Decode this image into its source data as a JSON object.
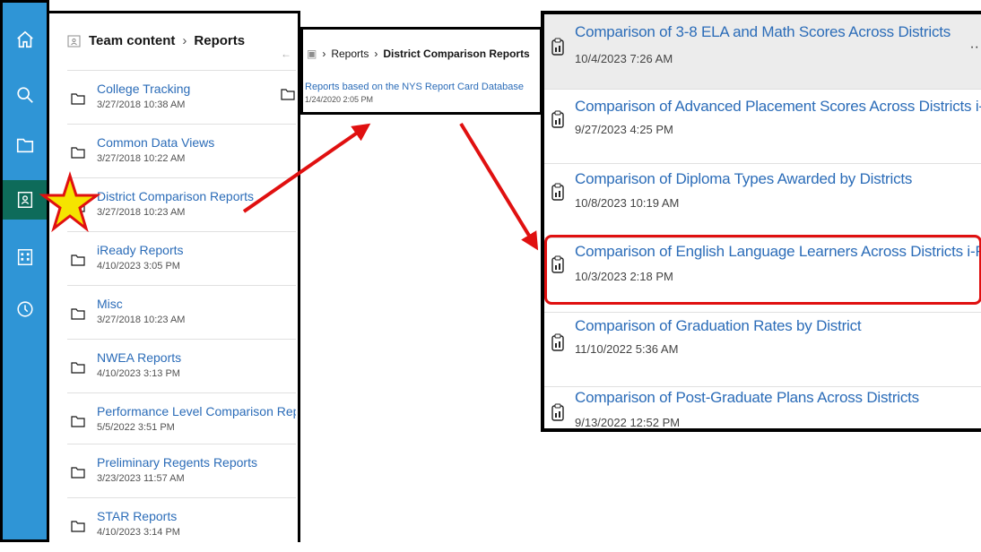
{
  "rail": {
    "items": [
      {
        "icon": "home-icon"
      },
      {
        "icon": "search-icon"
      },
      {
        "icon": "folder-icon"
      },
      {
        "icon": "team-content-icon",
        "active": true
      },
      {
        "icon": "building-icon"
      },
      {
        "icon": "clock-icon"
      }
    ],
    "active_color": "#0e6b5a",
    "background": "#2f95d6"
  },
  "panel1": {
    "breadcrumb": {
      "root": "Team content",
      "separator": "›",
      "current": "Reports"
    },
    "back_glyph": "←",
    "folders": [
      {
        "name": "College Tracking",
        "date": "3/27/2018 10:38 AM"
      },
      {
        "name": "Common Data Views",
        "date": "3/27/2018 10:22 AM"
      },
      {
        "name": "District Comparison Reports",
        "date": "3/27/2018 10:23 AM"
      },
      {
        "name": "iReady Reports",
        "date": "4/10/2023 3:05 PM"
      },
      {
        "name": "Misc",
        "date": "3/27/2018 10:23 AM"
      },
      {
        "name": "NWEA Reports",
        "date": "4/10/2023 3:13 PM"
      },
      {
        "name": "Performance Level Comparison Repor",
        "date": "5/5/2022 3:51 PM"
      },
      {
        "name": "Preliminary Regents Reports",
        "date": "3/23/2023 11:57 AM"
      },
      {
        "name": "STAR Reports",
        "date": "4/10/2023 3:14 PM"
      }
    ]
  },
  "panel2": {
    "breadcrumb": {
      "separator": "›",
      "parent": "Reports",
      "current": "District Comparison Reports"
    },
    "item": {
      "name": "Reports based on the NYS Report Card Database",
      "date": "1/24/2020 2:05 PM"
    }
  },
  "panel3": {
    "more_glyph": "··",
    "reports": [
      {
        "name": "Comparison of 3-8 ELA and Math Scores Across Districts",
        "date": "10/4/2023 7:26 AM"
      },
      {
        "name": "Comparison of Advanced Placement Scores Across Districts i-Report",
        "date": "9/27/2023 4:25 PM"
      },
      {
        "name": "Comparison of Diploma Types Awarded by Districts",
        "date": "10/8/2023 10:19 AM"
      },
      {
        "name": "Comparison of English Language Learners Across Districts i-Report",
        "date": "10/3/2023 2:18 PM"
      },
      {
        "name": "Comparison of Graduation Rates by District",
        "date": "11/10/2022 5:36 AM"
      },
      {
        "name": "Comparison of Post-Graduate Plans Across Districts",
        "date": "9/13/2022 12:52 PM"
      }
    ]
  },
  "annotations": {
    "arrow_color": "#e01010",
    "star_color": "#f5e400",
    "highlight_color": "#e01010"
  }
}
